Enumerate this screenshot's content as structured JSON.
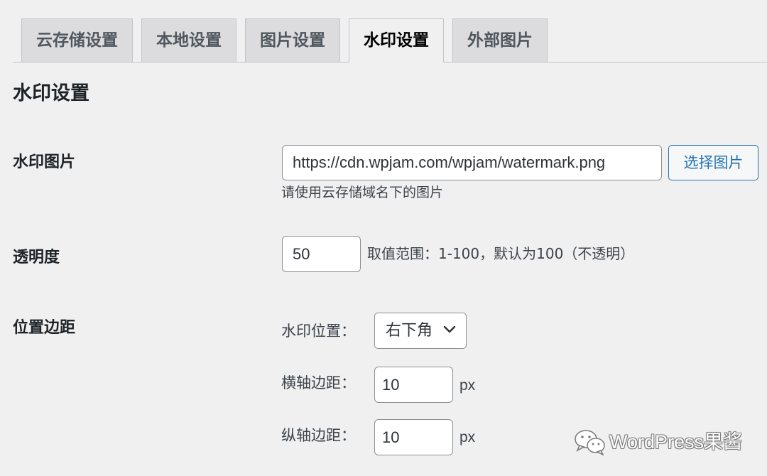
{
  "tabs": [
    {
      "label": "云存储设置"
    },
    {
      "label": "本地设置"
    },
    {
      "label": "图片设置"
    },
    {
      "label": "水印设置"
    },
    {
      "label": "外部图片"
    }
  ],
  "active_tab": "水印设置",
  "section_title": "水印设置",
  "watermark_image": {
    "label": "水印图片",
    "value": "https://cdn.wpjam.com/wpjam/watermark.png",
    "button_label": "选择图片",
    "description": "请使用云存储域名下的图片"
  },
  "opacity": {
    "label": "透明度",
    "value": "50",
    "description": "取值范围：1-100，默认为100（不透明）"
  },
  "position_margin": {
    "label": "位置边距",
    "position_label": "水印位置：",
    "position_value": "右下角",
    "x_margin_label": "横轴边距：",
    "x_margin_value": "10",
    "y_margin_label": "纵轴边距：",
    "y_margin_value": "10",
    "unit": "px"
  },
  "watermark_overlay": {
    "text": "WordPress果酱",
    "icon": "wechat-icon"
  },
  "colors": {
    "accent": "#2271b1",
    "background": "#f0f0f1",
    "tab_inactive": "#dcdcde",
    "border": "#8c8f94"
  }
}
